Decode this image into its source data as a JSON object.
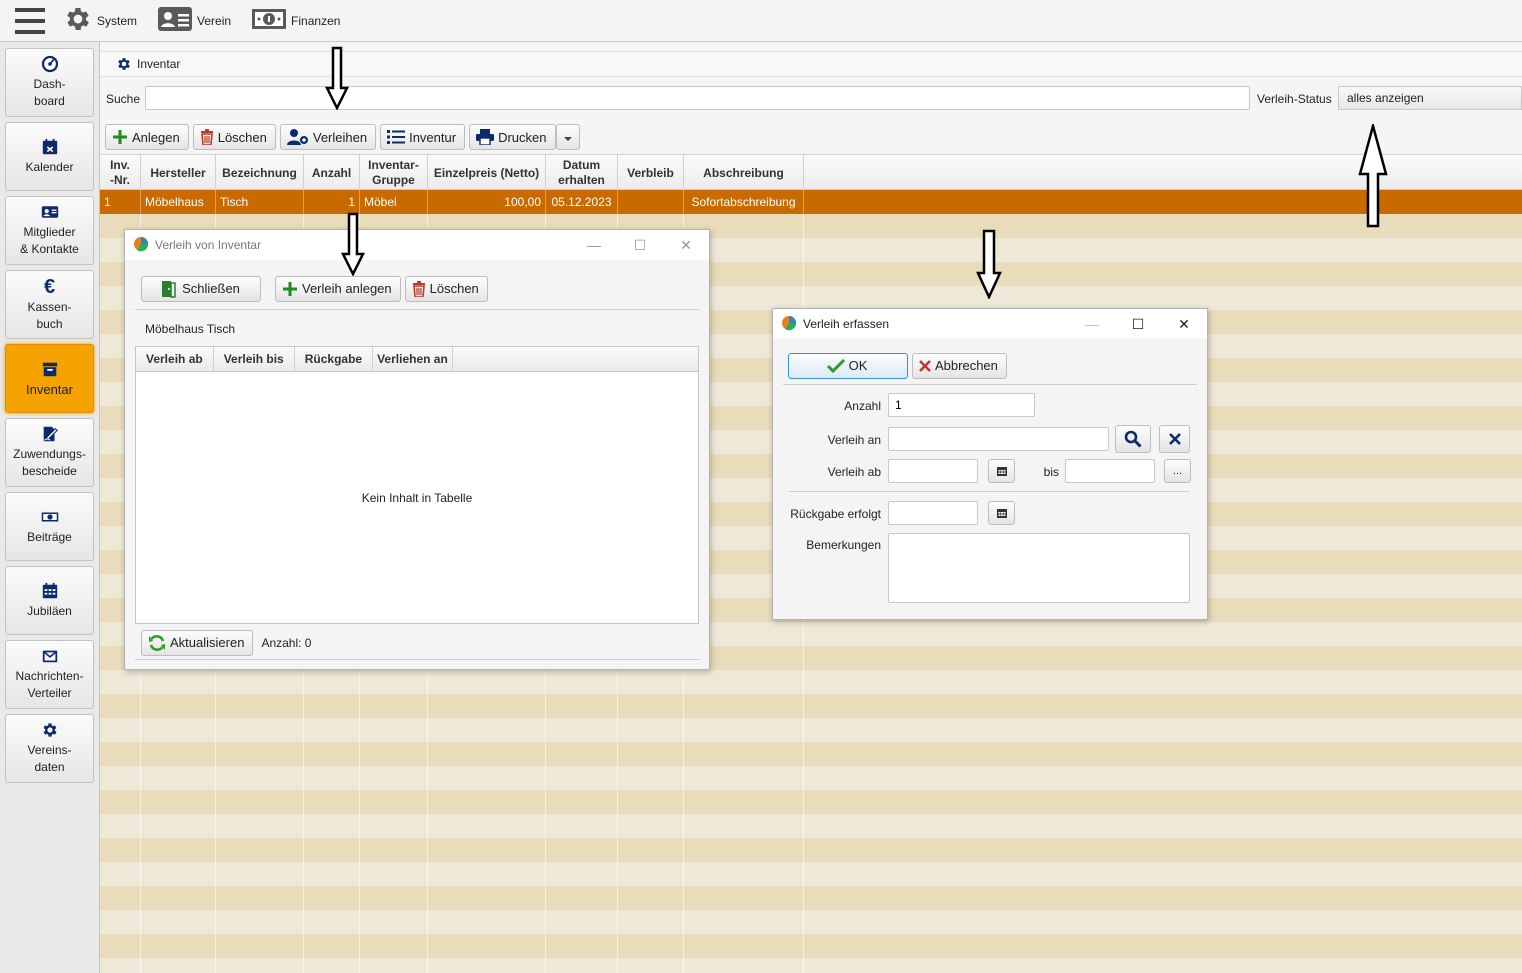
{
  "topmenu": {
    "system": "System",
    "verein": "Verein",
    "finanzen": "Finanzen"
  },
  "sidebar": {
    "items": [
      {
        "label": "Dash-\nboard",
        "icon": "dashboard-icon"
      },
      {
        "label": "Kalender",
        "icon": "calendar-icon"
      },
      {
        "label": "Mitglieder\n& Kontakte",
        "icon": "contacts-icon"
      },
      {
        "label": "Kassen-\nbuch",
        "icon": "euro-icon"
      },
      {
        "label": "Inventar",
        "icon": "archive-icon"
      },
      {
        "label": "Zuwendungs-\nbescheide",
        "icon": "signature-icon"
      },
      {
        "label": "Beiträge",
        "icon": "money-icon"
      },
      {
        "label": "Jubiläen",
        "icon": "calendar-grid-icon"
      },
      {
        "label": "Nachrichten-\nVerteiler",
        "icon": "envelope-icon"
      },
      {
        "label": "Vereins-\ndaten",
        "icon": "gear-icon"
      }
    ],
    "active_index": 4,
    "active_color": "#f4a300"
  },
  "breadcrumb": {
    "label": "Inventar"
  },
  "search": {
    "label": "Suche",
    "value": "",
    "status_label": "Verleih-Status",
    "status_value": "alles anzeigen"
  },
  "toolbar": {
    "anlegen": "Anlegen",
    "loeschen": "Löschen",
    "verleihen": "Verleihen",
    "inventur": "Inventur",
    "drucken": "Drucken"
  },
  "table": {
    "columns": [
      "Inv.\n-Nr.",
      "Hersteller",
      "Bezeichnung",
      "Anzahl",
      "Inventar-\nGruppe",
      "Einzelpreis (Netto)",
      "Datum\nerhalten",
      "Verbleib",
      "Abschreibung"
    ],
    "rows": [
      {
        "nr": "1",
        "hersteller": "Möbelhaus",
        "bezeichnung": "Tisch",
        "anzahl": "1",
        "gruppe": "Möbel",
        "preis": "100,00",
        "datum": "05.12.2023",
        "verbleib": "",
        "abschreibung": "Sofortabschreibung"
      }
    ],
    "selected_color": "#c96a00"
  },
  "dialog_verleih": {
    "title": "Verleih von Inventar",
    "schliessen": "Schließen",
    "verleih_anlegen": "Verleih anlegen",
    "loeschen": "Löschen",
    "subtitle": "Möbelhaus Tisch",
    "columns": [
      "Verleih ab",
      "Verleih bis",
      "Rückgabe",
      "Verliehen an"
    ],
    "empty_text": "Kein Inhalt in Tabelle",
    "aktualisieren": "Aktualisieren",
    "count_text": "Anzahl: 0"
  },
  "dialog_erfassen": {
    "title": "Verleih erfassen",
    "ok": "OK",
    "abbrechen": "Abbrechen",
    "anzahl_label": "Anzahl",
    "anzahl_value": "1",
    "verleih_an_label": "Verleih an",
    "verleih_an_value": "",
    "verleih_ab_label": "Verleih ab",
    "bis_label": "bis",
    "dots": "...",
    "rueckgabe_label": "Rückgabe erfolgt",
    "bemerkungen_label": "Bemerkungen"
  }
}
